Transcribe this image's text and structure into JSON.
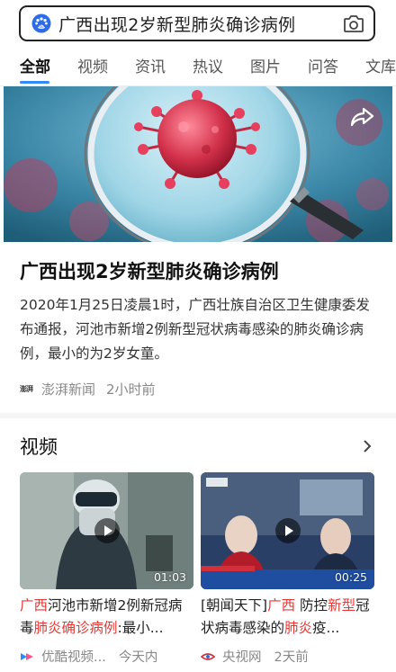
{
  "search": {
    "query": "广西出现2岁新型肺炎确诊病例",
    "logo_icon": "baidu-paw-icon",
    "camera_icon": "camera-icon"
  },
  "tabs": [
    {
      "label": "全部",
      "active": true
    },
    {
      "label": "视频"
    },
    {
      "label": "资讯"
    },
    {
      "label": "热议"
    },
    {
      "label": "图片"
    },
    {
      "label": "问答"
    },
    {
      "label": "文库"
    }
  ],
  "article": {
    "title": "广西出现2岁新型肺炎确诊病例",
    "summary": "2020年1月25日凌晨1时，广西壮族自治区卫生健康委发布通报，河池市新增2例新型冠状病毒感染的肺炎确诊病例，最小的为2岁女童。",
    "source_logo_text": "澎湃",
    "source": "澎湃新闻",
    "time": "2小时前",
    "share_icon": "share-icon"
  },
  "videos": {
    "heading": "视频",
    "more_icon": "chevron-right-icon",
    "items": [
      {
        "duration": "01:03",
        "title_parts": [
          {
            "text": "广西",
            "hl": true
          },
          {
            "text": "河池市新增2例新冠病毒",
            "hl": false
          },
          {
            "text": "肺炎确诊病例",
            "hl": true
          },
          {
            "text": ":最小...",
            "hl": false
          }
        ],
        "source": "优酷视频...",
        "time": "今天内"
      },
      {
        "duration": "00:25",
        "title_parts": [
          {
            "text": "[朝闻天下]",
            "hl": false
          },
          {
            "text": "广西",
            "hl": true
          },
          {
            "text": " 防控",
            "hl": false
          },
          {
            "text": "新型",
            "hl": true
          },
          {
            "text": "冠状病毒感染的",
            "hl": false
          },
          {
            "text": "肺炎",
            "hl": true
          },
          {
            "text": "疫...",
            "hl": false
          }
        ],
        "source": "央视网",
        "time": "2天前"
      }
    ]
  },
  "colors": {
    "accent": "#3388ff",
    "highlight": "#e53935"
  }
}
